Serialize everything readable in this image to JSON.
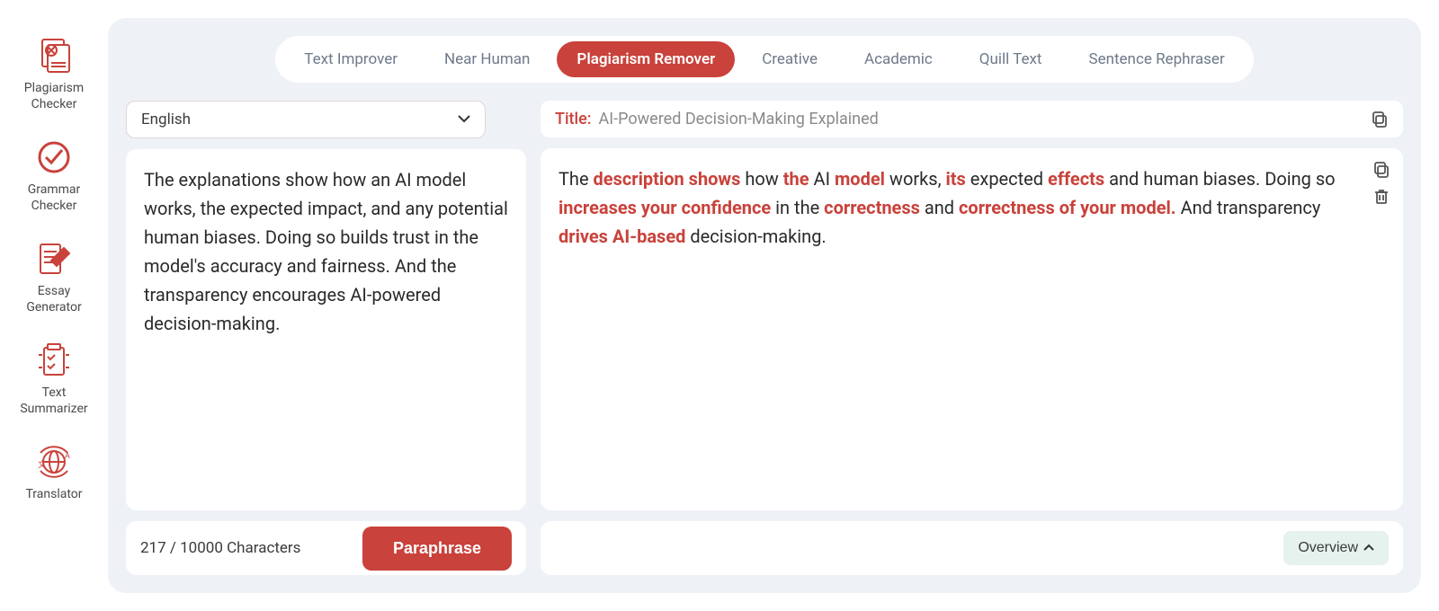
{
  "sidebar": {
    "items": [
      {
        "label": "Plagiarism Checker"
      },
      {
        "label": "Grammar Checker"
      },
      {
        "label": "Essay Generator"
      },
      {
        "label": "Text Summarizer"
      },
      {
        "label": "Translator"
      }
    ]
  },
  "tabs": [
    {
      "label": "Text Improver"
    },
    {
      "label": "Near Human"
    },
    {
      "label": "Plagiarism Remover"
    },
    {
      "label": "Creative"
    },
    {
      "label": "Academic"
    },
    {
      "label": "Quill Text"
    },
    {
      "label": "Sentence Rephraser"
    }
  ],
  "active_tab_index": 2,
  "language": {
    "selected": "English"
  },
  "title": {
    "label": "Title:",
    "text": "AI-Powered Decision-Making Explained"
  },
  "input_text": "The explanations show how an AI model works, the expected impact, and any potential human biases. Doing so builds trust in the model's accuracy and fairness. And the transparency encourages AI-powered decision-making.",
  "output_tokens": [
    {
      "t": "The ",
      "h": false
    },
    {
      "t": "description shows",
      "h": true
    },
    {
      "t": " how ",
      "h": false
    },
    {
      "t": "the",
      "h": true
    },
    {
      "t": " AI ",
      "h": false
    },
    {
      "t": "model",
      "h": true
    },
    {
      "t": " works, ",
      "h": false
    },
    {
      "t": "its",
      "h": true
    },
    {
      "t": " expected ",
      "h": false
    },
    {
      "t": "effects",
      "h": true
    },
    {
      "t": " and human biases. Doing so ",
      "h": false
    },
    {
      "t": "increases your confidence",
      "h": true
    },
    {
      "t": " in the ",
      "h": false
    },
    {
      "t": "correctness",
      "h": true
    },
    {
      "t": " and ",
      "h": false
    },
    {
      "t": "correctness of your model.",
      "h": true
    },
    {
      "t": " And transparency ",
      "h": false
    },
    {
      "t": "drives AI-based",
      "h": true
    },
    {
      "t": " decision-making.",
      "h": false
    }
  ],
  "footer": {
    "char_count": "217 / 10000 Characters",
    "paraphrase_label": "Paraphrase",
    "overview_label": "Overview"
  },
  "icons": {
    "chevron_down": "⌄",
    "chevron_up": "⌃"
  }
}
